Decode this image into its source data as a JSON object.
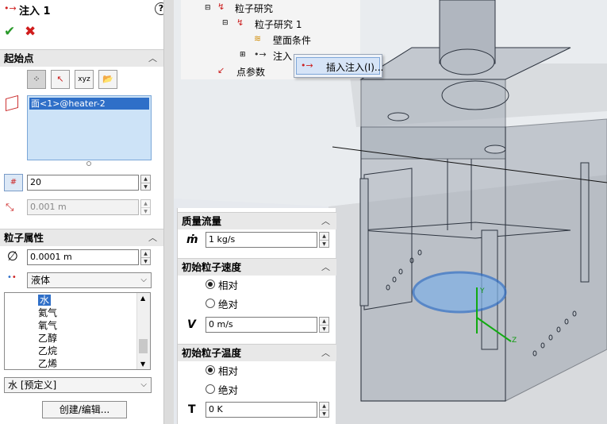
{
  "feature": {
    "title": "注入 1",
    "help_icon": "?",
    "ok_icon": "✔",
    "cancel_icon": "✖"
  },
  "start_point": {
    "header": "起始点",
    "face_item": "面<1>@heater-2",
    "count_value": "20",
    "spacing_value": "0.001 m"
  },
  "particle_props": {
    "header": "粒子属性",
    "diameter_value": "0.0001 m",
    "phase_value": "液体",
    "materials": [
      "水",
      "氦气",
      "氧气",
      "乙醇",
      "乙烷",
      "乙烯"
    ],
    "selected_material": "水 [预定义]",
    "create_edit_label": "创建/编辑..."
  },
  "tree": {
    "items": [
      "粒子研究",
      "粒子研究 1",
      "壁面条件",
      "注入",
      "点参数"
    ],
    "context_menu_item": "插入注入(I)..."
  },
  "mass_flow": {
    "header": "质量流量",
    "symbol": "ṁ",
    "value": "1 kg/s"
  },
  "velocity": {
    "header": "初始粒子速度",
    "opt_relative": "相对",
    "opt_absolute": "绝对",
    "symbol": "V",
    "value": "0 m/s"
  },
  "temperature": {
    "header": "初始粒子温度",
    "opt_relative": "相对",
    "opt_absolute": "绝对",
    "symbol": "T",
    "value": "0 K"
  },
  "axis_labels": {
    "y": "Y",
    "z": "Z"
  },
  "colors": {
    "accent_blue": "#2f6fc8",
    "selection_bg": "#cde3f7",
    "ok_green": "#2a9a2a",
    "cancel_red": "#d01c1c"
  }
}
